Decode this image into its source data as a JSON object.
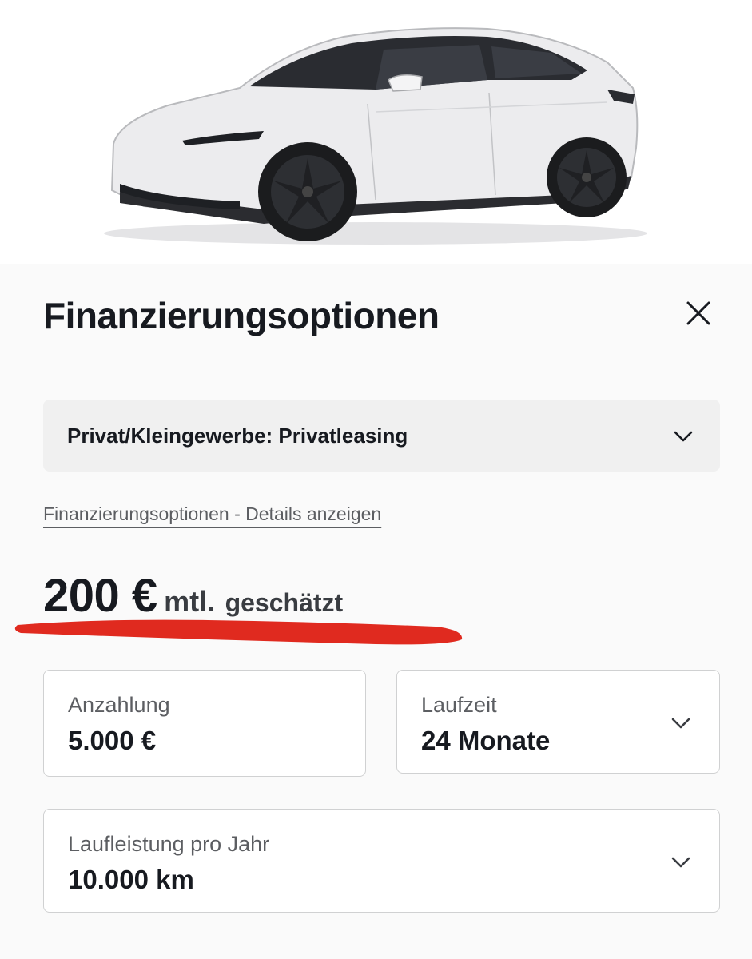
{
  "hero": {
    "image": "white-suv-car",
    "colors": {
      "body": "#e9e9eb",
      "glass": "#222428",
      "tire": "#1b1c1e"
    }
  },
  "modal": {
    "title": "Finanzierungsoptionen",
    "close_icon": "close-icon"
  },
  "financing_type": {
    "selected": "Privat/Kleingewerbe: Privatleasing",
    "icon": "chevron-down-icon"
  },
  "details_link": "Finanzierungsoptionen - Details anzeigen",
  "price": {
    "amount": "200 €",
    "period": "mtl.",
    "note": "geschätzt",
    "highlight_color": "#e02a1f"
  },
  "fields": {
    "down_payment": {
      "label": "Anzahlung",
      "value": "5.000 €"
    },
    "term": {
      "label": "Laufzeit",
      "value": "24 Monate"
    },
    "mileage": {
      "label": "Laufleistung pro Jahr",
      "value": "10.000 km"
    }
  }
}
